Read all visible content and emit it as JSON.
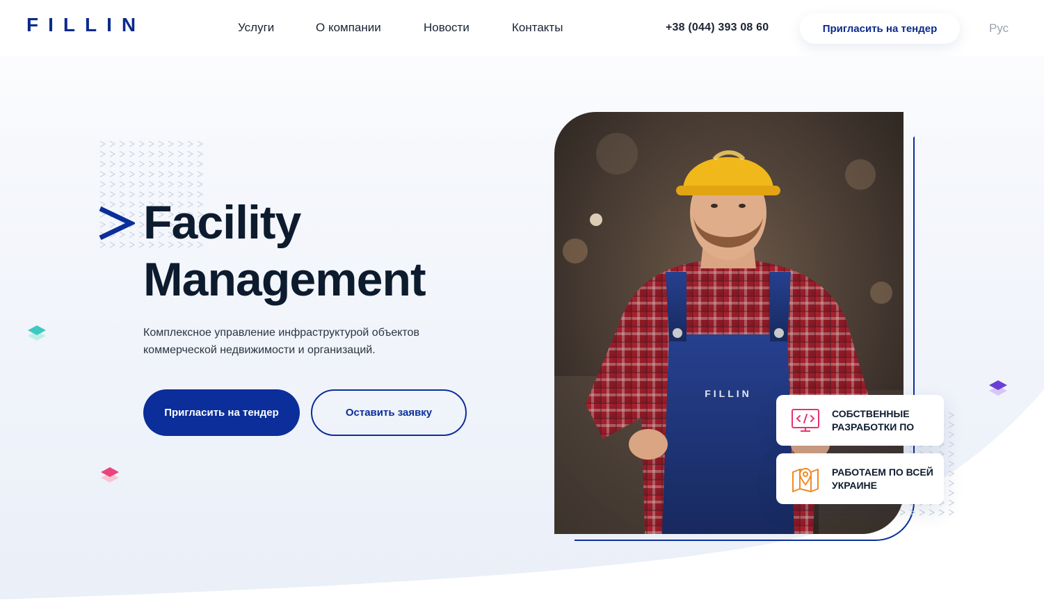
{
  "brand": {
    "logo_text": "FILLIN",
    "logo_color": "#0b2a8c"
  },
  "nav": {
    "items": [
      {
        "label": "Услуги"
      },
      {
        "label": "О компании"
      },
      {
        "label": "Новости"
      },
      {
        "label": "Контакты"
      }
    ],
    "phone": "+38 (044) 393 08 60",
    "cta_label": "Пригласить на тендер",
    "language": "Рус"
  },
  "hero": {
    "title_line1": "Facility",
    "title_line2": "Management",
    "subtitle": "Комплексное управление инфраструктурой объектов коммерческой недвижимости и организаций.",
    "primary_button": "Пригласить на тендер",
    "secondary_button": "Оставить заявку",
    "overall_logo": "FILLIN"
  },
  "features": [
    {
      "label": "Собственные разработки ПО",
      "icon": "code-monitor-icon"
    },
    {
      "label": "Работаем по всей Украине",
      "icon": "map-pin-icon"
    }
  ],
  "colors": {
    "primary": "#0b2e9a",
    "text_dark": "#0d1b2e",
    "accent_teal": "#3ec9c0",
    "accent_pink": "#e9447a",
    "accent_purple": "#6b3fd6",
    "icon_pink": "#e8336e",
    "icon_orange": "#f08a24"
  }
}
